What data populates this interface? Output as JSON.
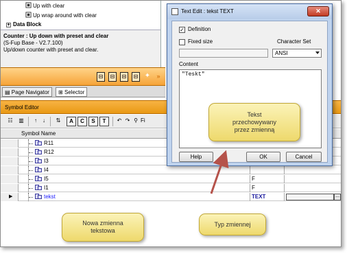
{
  "tree": {
    "items": [
      {
        "label": "Up with clear"
      },
      {
        "label": "Up wrap around with clear"
      }
    ],
    "section": "Data Block"
  },
  "description": {
    "title": "Counter : Up down with preset and clear",
    "version": "(S-Fup Base - V2.7.100)",
    "text": "Up/down counter with preset and clear."
  },
  "nav_tabs": {
    "page_navigator": "Page Navigator",
    "selector": "Selector"
  },
  "symbol_editor": {
    "title": "Symbol Editor",
    "toolbar": {
      "a": "A",
      "c": "C",
      "s": "S",
      "t": "T",
      "find": "Fi"
    },
    "columns": {
      "symbol_name": "Symbol Name"
    },
    "rows": [
      {
        "name": "R11",
        "type": ""
      },
      {
        "name": "R12",
        "type": ""
      },
      {
        "name": "I3",
        "type": ""
      },
      {
        "name": "I4",
        "type": ""
      },
      {
        "name": "I5",
        "type": "F"
      },
      {
        "name": "I1",
        "type": "F"
      },
      {
        "name": "tekst",
        "type": "TEXT"
      }
    ],
    "current_row_marker": "▶"
  },
  "dialog": {
    "title": "Text Edit : tekst TEXT",
    "close": "✕",
    "definition_label": "Definition",
    "definition_checked": "✓",
    "fixed_size_label": "Fixed size",
    "charset_label": "Character Set",
    "charset_value": "ANSI",
    "content_label": "Content",
    "content_value": "\"Teskt\"",
    "help": "Help",
    "ok": "OK",
    "cancel": "Cancel"
  },
  "callouts": {
    "text_var": [
      "Tekst",
      "przechowywany",
      "przez zmienną"
    ],
    "new_var": [
      "Nowa zmienna",
      "tekstowa"
    ],
    "type_var": "Typ zmiennej"
  },
  "colors": {
    "orange": "#f6a338",
    "callout": "#f3e28a",
    "arrow": "#b5524a"
  }
}
